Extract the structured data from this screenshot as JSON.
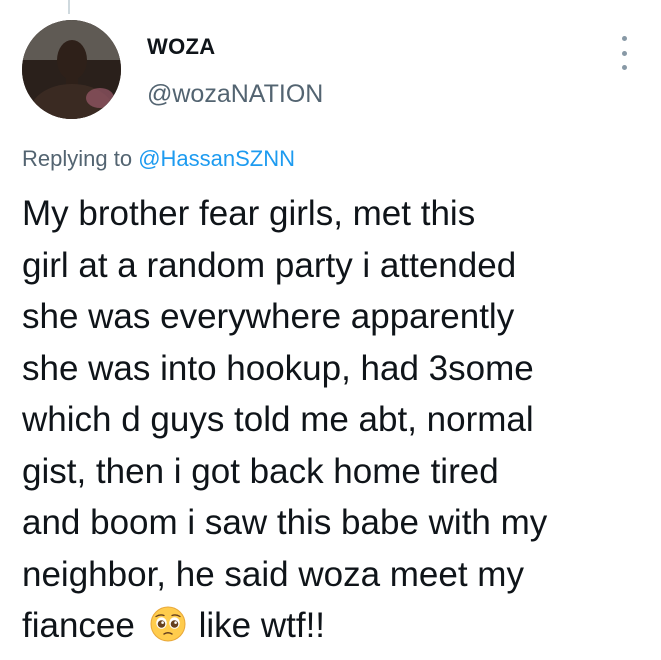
{
  "tweet": {
    "author": {
      "display_name": "WOZA",
      "handle": "@wozaNATION"
    },
    "reply_context": {
      "prefix": "Replying to ",
      "mention": "@HassanSZNN"
    },
    "text_lines": [
      "My brother fear girls, met this",
      "girl at a random party i attended",
      "she was everywhere apparently",
      "she was into hookup, had 3some",
      "which d guys told me abt, normal",
      "gist, then i got back home tired",
      "and boom i saw this babe with my",
      "neighbor, he said woza meet my"
    ],
    "last_line": {
      "before_emoji": "fiancee",
      "emoji": "pleading-face-icon",
      "after_emoji": "like wtf!!"
    }
  },
  "colors": {
    "text_primary": "#0f1419",
    "text_secondary": "#536471",
    "link": "#1d9bf0",
    "more_dots": "#8899a6"
  }
}
